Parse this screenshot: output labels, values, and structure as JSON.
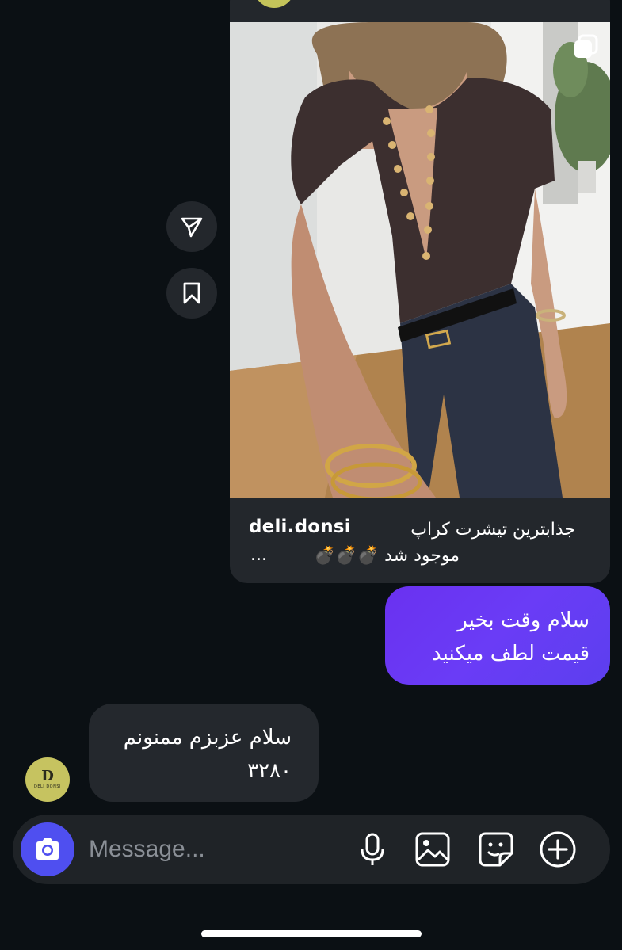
{
  "shared_post": {
    "username": "deli.donsi",
    "caption_line1": "جذابترین تیشرت کراپ",
    "caption_line2": "موجود شد 💣💣💣",
    "caption_ellipsis": "..."
  },
  "messages": [
    {
      "direction": "outgoing",
      "text": "سلام وقت بخیر\nقیمت لطف میکنید"
    },
    {
      "direction": "incoming",
      "text": "سلام عزبزم ممنونم\n۳۲۸۰"
    }
  ],
  "sender_avatar": {
    "logo": "D",
    "label": "DELI DONSI"
  },
  "composer": {
    "placeholder": "Message..."
  },
  "colors": {
    "background": "#0b1014",
    "outgoing_bubble": "#6a3cf6",
    "incoming_bubble": "#24282d",
    "camera_button": "#4f4ff0",
    "avatar": "#c6c360"
  },
  "icons": [
    "multiple-images-icon",
    "share-icon",
    "bookmark-icon",
    "camera-icon",
    "microphone-icon",
    "gallery-icon",
    "sticker-icon",
    "plus-icon"
  ]
}
